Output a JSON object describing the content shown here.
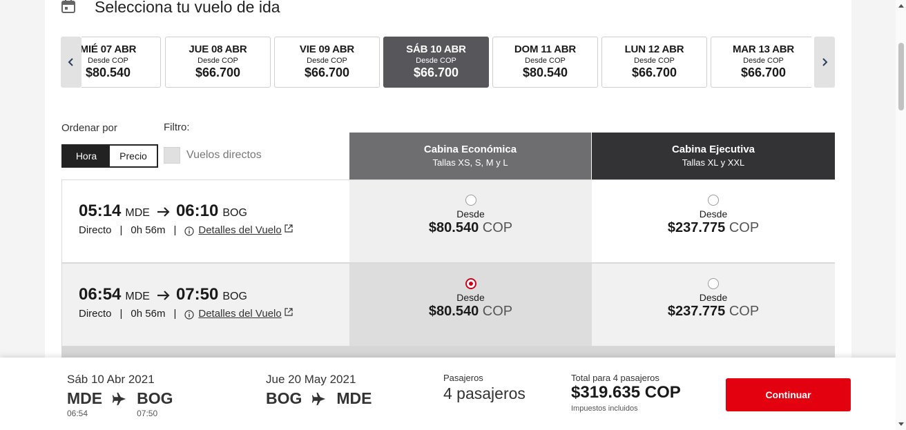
{
  "header": {
    "title": "Selecciona tu vuelo de ida",
    "icon": "calendar-icon"
  },
  "date_strip": {
    "prev_icon": "chevron-left-icon",
    "next_icon": "chevron-right-icon",
    "dates": [
      {
        "label": "MIÉ 07 ABR",
        "from": "Desde COP",
        "price": "$80.540"
      },
      {
        "label": "JUE 08 ABR",
        "from": "Desde COP",
        "price": "$66.700"
      },
      {
        "label": "VIE 09 ABR",
        "from": "Desde COP",
        "price": "$66.700"
      },
      {
        "label": "SÁB 10 ABR",
        "from": "Desde COP",
        "price": "$66.700",
        "active": true
      },
      {
        "label": "DOM 11 ABR",
        "from": "Desde COP",
        "price": "$80.540"
      },
      {
        "label": "LUN 12 ABR",
        "from": "Desde COP",
        "price": "$66.700"
      },
      {
        "label": "MAR 13 ABR",
        "from": "Desde COP",
        "price": "$66.700"
      }
    ]
  },
  "sort": {
    "label": "Ordenar por",
    "options": [
      "Hora",
      "Precio"
    ],
    "selected": "Hora"
  },
  "filter": {
    "label": "Filtro:",
    "direct_label": "Vuelos directos",
    "direct_checked": false
  },
  "cabins": [
    {
      "title": "Cabina Económica",
      "subtitle": "Tallas XS, S, M y L"
    },
    {
      "title": "Cabina Ejecutiva",
      "subtitle": "Tallas XL y XXL"
    }
  ],
  "flights": [
    {
      "dep_time": "05:14",
      "dep_code": "MDE",
      "arr_time": "06:10",
      "arr_code": "BOG",
      "type": "Directo",
      "duration": "0h 56m",
      "details": "Detalles del Vuelo",
      "eco": {
        "from": "Desde",
        "price": "$80.540",
        "currency": "COP",
        "selected": false
      },
      "exe": {
        "from": "Desde",
        "price": "$237.775",
        "currency": "COP",
        "selected": false
      }
    },
    {
      "dep_time": "06:54",
      "dep_code": "MDE",
      "arr_time": "07:50",
      "arr_code": "BOG",
      "type": "Directo",
      "duration": "0h 56m",
      "details": "Detalles del Vuelo",
      "eco": {
        "from": "Desde",
        "price": "$80.540",
        "currency": "COP",
        "selected": true
      },
      "exe": {
        "from": "Desde",
        "price": "$237.775",
        "currency": "COP",
        "selected": false
      }
    }
  ],
  "summary": {
    "outbound": {
      "date": "Sáb 10 Abr 2021",
      "from": "MDE",
      "to": "BOG",
      "dep_time": "06:54",
      "arr_time": "07:50"
    },
    "return": {
      "date": "Jue 20 May 2021",
      "from": "BOG",
      "to": "MDE"
    },
    "pax_label": "Pasajeros",
    "pax_value": "4 pasajeros",
    "total_label": "Total para 4 pasajeros",
    "total_value": "$319.635 COP",
    "total_note": "Impuestos incluidos",
    "continue_label": "Continuar"
  },
  "colors": {
    "accent": "#e3000f",
    "selected_radio": "#d0021b",
    "active_date": "#57575b",
    "eco_header": "#6e6e71",
    "exe_header": "#333336"
  }
}
